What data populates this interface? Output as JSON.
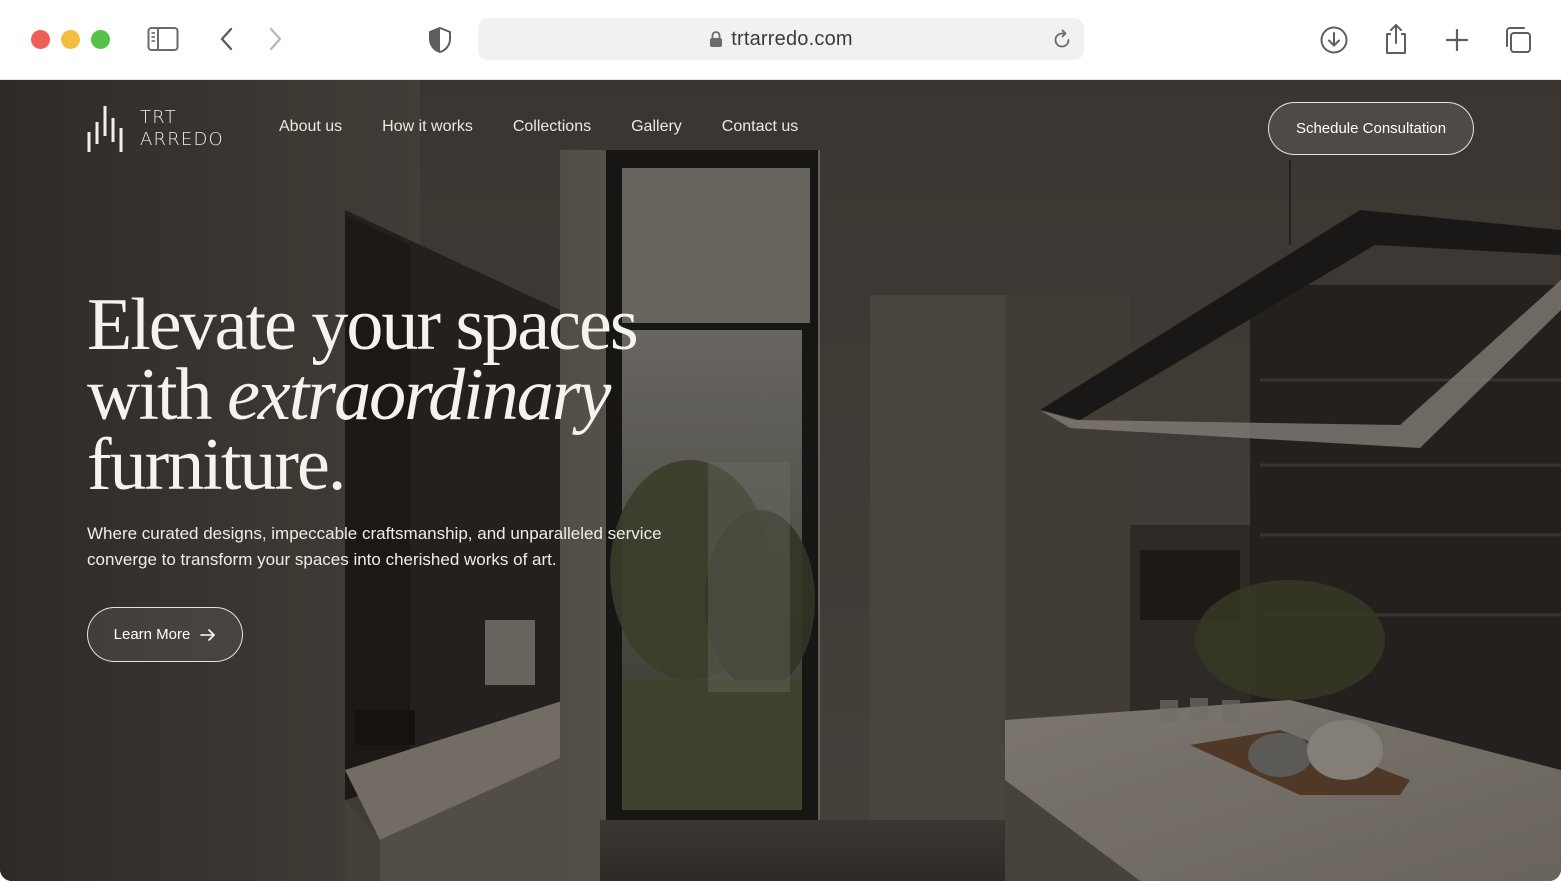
{
  "browser": {
    "url": "trtarredo.com",
    "icons": [
      "sidebar-icon",
      "back-icon",
      "forward-icon",
      "shield-icon",
      "lock-icon",
      "reload-icon",
      "download-icon",
      "share-icon",
      "new-tab-icon",
      "tabs-overview-icon"
    ]
  },
  "site": {
    "logo": {
      "line1": "TRT",
      "line2": "ARREDO"
    },
    "nav": [
      "About us",
      "How it works",
      "Collections",
      "Gallery",
      "Contact us"
    ],
    "cta_label": "Schedule Consultation"
  },
  "hero": {
    "headline_line1": "Elevate your spaces",
    "headline_line2_prefix": "with ",
    "headline_line2_italic": "extraordinary",
    "headline_line3": "furniture.",
    "subtext": "Where curated designs, impeccable craftsmanship, and unparalleled service converge to transform your spaces into cherished works of art.",
    "button_label": "Learn More",
    "button_icon": "arrow-right-icon"
  },
  "colors": {
    "traffic_red": "#ee5d57",
    "traffic_yellow": "#f5bd3f",
    "traffic_green": "#57c24a",
    "url_bar_bg": "#f1f1f2",
    "hero_text": "#f6f3ee"
  }
}
